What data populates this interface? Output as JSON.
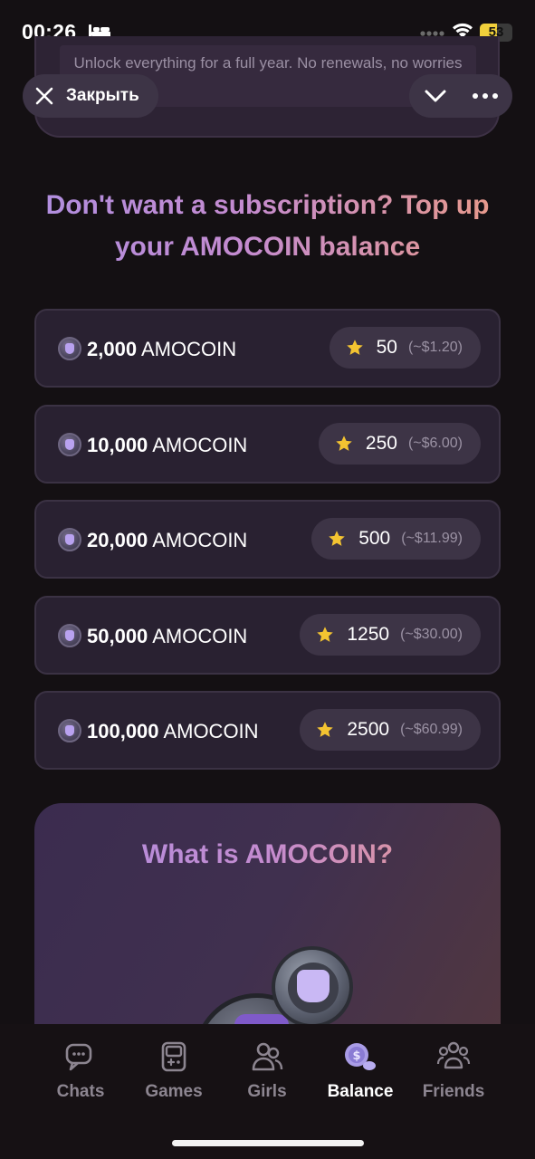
{
  "status_bar": {
    "time": "00:26",
    "battery": "53",
    "battery_level": 0.53
  },
  "plan_card": {
    "text": "Unlock everything for a full year. No renewals, no worries"
  },
  "overlay": {
    "close_label": "Закрыть"
  },
  "topup": {
    "heading": "Don't want a subscription? Top up your AMOCOIN balance"
  },
  "packages": [
    {
      "amount": "2,000",
      "unit": "AMOCOIN",
      "stars": "50",
      "usd": "(~$1.20)"
    },
    {
      "amount": "10,000",
      "unit": "AMOCOIN",
      "stars": "250",
      "usd": "(~$6.00)"
    },
    {
      "amount": "20,000",
      "unit": "AMOCOIN",
      "stars": "500",
      "usd": "(~$11.99)"
    },
    {
      "amount": "50,000",
      "unit": "AMOCOIN",
      "stars": "1250",
      "usd": "(~$30.00)"
    },
    {
      "amount": "100,000",
      "unit": "AMOCOIN",
      "stars": "2500",
      "usd": "(~$60.99)"
    }
  ],
  "what_is": {
    "title": "What is AMOCOIN?"
  },
  "tabs": [
    {
      "label": "Chats",
      "icon": "chat-bubbles-icon",
      "active": false
    },
    {
      "label": "Games",
      "icon": "game-console-icon",
      "active": false
    },
    {
      "label": "Girls",
      "icon": "people-icon",
      "active": false
    },
    {
      "label": "Balance",
      "icon": "coin-balance-icon",
      "active": true
    },
    {
      "label": "Friends",
      "icon": "friends-group-icon",
      "active": false
    }
  ],
  "colors": {
    "accent_purple": "#b08ee0",
    "accent_peach": "#e99a88",
    "star": "#f4c431",
    "background": "#141013"
  }
}
